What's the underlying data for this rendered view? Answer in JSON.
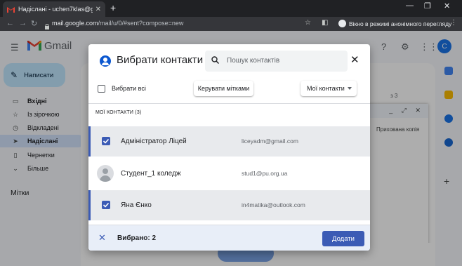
{
  "browser": {
    "tab_title": "Надіслані - uchen7klas@gmail.c",
    "url_host": "mail.google.com",
    "url_path": "/mail/u/0/#sent?compose=new",
    "incognito_label": "Вікно в режимі анонімного перегляду"
  },
  "gmail": {
    "brand": "Gmail",
    "compose_label": "Написати",
    "nav": [
      {
        "label": "Вхідні",
        "icon": "inbox-icon"
      },
      {
        "label": "Із зірочкою",
        "icon": "star-icon"
      },
      {
        "label": "Відкладені",
        "icon": "clock-icon"
      },
      {
        "label": "Надіслані",
        "icon": "send-icon"
      },
      {
        "label": "Чернетки",
        "icon": "draft-icon"
      },
      {
        "label": "Більше",
        "icon": "chevron-down-icon"
      }
    ],
    "labels_heading": "Мітки",
    "avatar_letter": "C",
    "pager_text": "з 3",
    "bcc_text": "Прихована копія"
  },
  "dialog": {
    "title": "Вибрати контакти",
    "search_placeholder": "Пошук контактів",
    "select_all_label": "Вибрати всі",
    "manage_labels_button": "Керувати мітками",
    "group_dropdown": "Мої контакти",
    "section_header": "МОЇ КОНТАКТИ (3)",
    "contacts": [
      {
        "name": "Адміністратор Ліцей",
        "email": "liceyadm@gmail.com",
        "selected": true
      },
      {
        "name": "Студент_1 коледж",
        "email": "stud1@pu.org.ua",
        "selected": false
      },
      {
        "name": "Яна Єнко",
        "email": "in4matika@outlook.com",
        "selected": true
      }
    ],
    "selected_text": "Вибрано: 2",
    "add_button": "Додати"
  },
  "colors": {
    "accent": "#3b5bb5",
    "selected_row": "#e8eaed",
    "footer_bg": "#e8eef8"
  }
}
